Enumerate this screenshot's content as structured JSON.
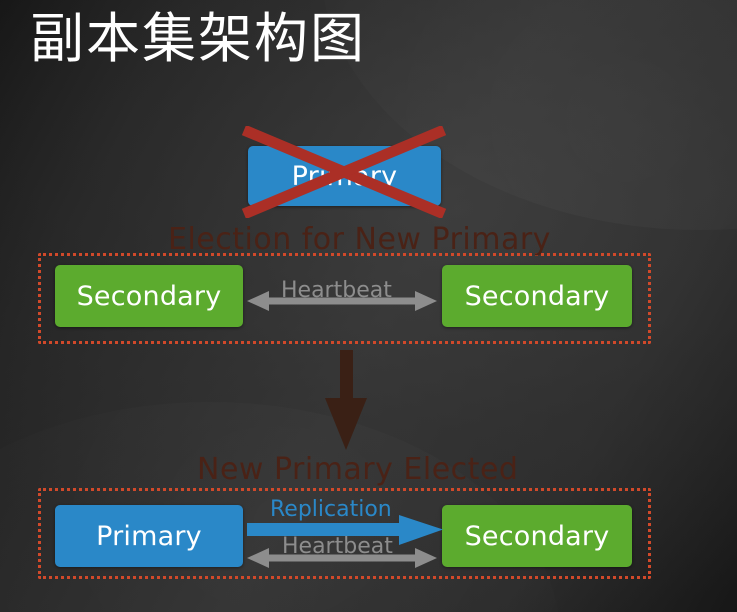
{
  "slide": {
    "title": "副本集架构图",
    "background_color": "#2d2d2d"
  },
  "colors": {
    "primary_box": "#2a88c8",
    "secondary_box": "#5cab2e",
    "group_border": "#d1492a",
    "cross_out": "#ab2f26",
    "caption_text": "#4a2216",
    "heartbeat_arrow": "#8d8d8d",
    "replication_arrow": "#2a88c8",
    "transition_arrow": "#3a2015",
    "box_text": "#ffffff",
    "title_text": "#ffffff"
  },
  "stage_one": {
    "caption": "Election for New Primary",
    "failed_node": {
      "label": "Primary",
      "state": "crossed-out",
      "icon": "cross-out-icon"
    },
    "nodes": [
      {
        "label": "Secondary",
        "role": "secondary"
      },
      {
        "label": "Secondary",
        "role": "secondary"
      }
    ],
    "links": [
      {
        "label": "Heartbeat",
        "direction": "bidirectional",
        "icon": "double-arrow-icon"
      }
    ]
  },
  "transition": {
    "icon": "down-arrow-icon",
    "direction": "down"
  },
  "stage_two": {
    "caption": "New Primary Elected",
    "nodes": [
      {
        "label": "Primary",
        "role": "primary"
      },
      {
        "label": "Secondary",
        "role": "secondary"
      }
    ],
    "links": [
      {
        "label": "Replication",
        "direction": "left-to-right",
        "icon": "right-arrow-icon"
      },
      {
        "label": "Heartbeat",
        "direction": "bidirectional",
        "icon": "double-arrow-icon"
      }
    ]
  }
}
